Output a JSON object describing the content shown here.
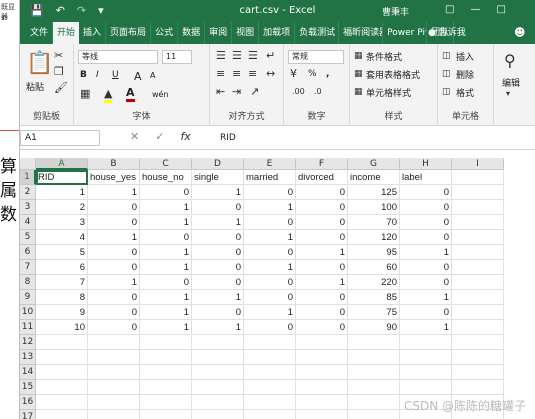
{
  "background_doc": {
    "label_top": "既显器",
    "label_num": "7",
    "chars": [
      "算",
      "属",
      "数"
    ]
  },
  "window": {
    "title": "cart.csv  -  Excel",
    "user": "曹秉丰",
    "qat_icons": [
      "save-icon",
      "undo-icon",
      "redo-icon",
      "customize-icon"
    ]
  },
  "tabs": [
    "文件",
    "开始",
    "插入",
    "页面布局",
    "公式",
    "数据",
    "审阅",
    "视图",
    "加载项",
    "负载测试",
    "福昕阅读器",
    "Power Pivot",
    "团队"
  ],
  "active_tab": "开始",
  "tell_me": "告诉我",
  "ribbon": {
    "clipboard": {
      "label": "剪贴板",
      "paste": "粘贴"
    },
    "font": {
      "label": "字体",
      "name": "等线",
      "size": "11",
      "bold": "B",
      "italic": "I",
      "underline": "U",
      "grow": "A",
      "shrink": "A",
      "wen": "wén"
    },
    "alignment": {
      "label": "对齐方式"
    },
    "number": {
      "label": "数字",
      "format": "常规",
      "percent": "%",
      "comma": ","
    },
    "styles": {
      "label": "样式",
      "conditional": "条件格式",
      "table": "套用表格格式",
      "cell": "单元格样式"
    },
    "cells": {
      "label": "单元格",
      "insert": "插入",
      "delete": "删除",
      "format": "格式"
    },
    "editing": {
      "label": "编辑"
    }
  },
  "formula_bar": {
    "name_box": "A1",
    "fx": "fx",
    "value": "RID"
  },
  "grid": {
    "columns": [
      "A",
      "B",
      "C",
      "D",
      "E",
      "F",
      "G",
      "H",
      "I"
    ],
    "row_numbers": [
      "1",
      "2",
      "3",
      "4",
      "5",
      "6",
      "7",
      "8",
      "9",
      "10",
      "11",
      "12",
      "13",
      "14",
      "15",
      "16",
      "17"
    ],
    "rows": [
      [
        "RID",
        "house_yes",
        "house_no",
        "single",
        "married",
        "divorced",
        "income",
        "label",
        ""
      ],
      [
        "1",
        "1",
        "0",
        "1",
        "0",
        "0",
        "125",
        "0",
        ""
      ],
      [
        "2",
        "0",
        "1",
        "0",
        "1",
        "0",
        "100",
        "0",
        ""
      ],
      [
        "3",
        "0",
        "1",
        "1",
        "0",
        "0",
        "70",
        "0",
        ""
      ],
      [
        "4",
        "1",
        "0",
        "0",
        "1",
        "0",
        "120",
        "0",
        ""
      ],
      [
        "5",
        "0",
        "1",
        "0",
        "0",
        "1",
        "95",
        "1",
        ""
      ],
      [
        "6",
        "0",
        "1",
        "0",
        "1",
        "0",
        "60",
        "0",
        ""
      ],
      [
        "7",
        "1",
        "0",
        "0",
        "0",
        "1",
        "220",
        "0",
        ""
      ],
      [
        "8",
        "0",
        "1",
        "1",
        "0",
        "0",
        "85",
        "1",
        ""
      ],
      [
        "9",
        "0",
        "1",
        "0",
        "1",
        "0",
        "75",
        "0",
        ""
      ],
      [
        "10",
        "0",
        "1",
        "1",
        "0",
        "0",
        "90",
        "1",
        ""
      ],
      [
        "",
        "",
        "",
        "",
        "",
        "",
        "",
        "",
        ""
      ],
      [
        "",
        "",
        "",
        "",
        "",
        "",
        "",
        "",
        ""
      ],
      [
        "",
        "",
        "",
        "",
        "",
        "",
        "",
        "",
        ""
      ],
      [
        "",
        "",
        "",
        "",
        "",
        "",
        "",
        "",
        ""
      ],
      [
        "",
        "",
        "",
        "",
        "",
        "",
        "",
        "",
        ""
      ],
      [
        "",
        "",
        "",
        "",
        "",
        "",
        "",
        "",
        ""
      ]
    ]
  },
  "watermark": "CSDN @陈陈的糖罐子",
  "colors": {
    "excel_green": "#217346",
    "ribbon_bg": "#f3f3f3",
    "font_red": "#c00000",
    "highlight_yellow": "#ffff00"
  }
}
